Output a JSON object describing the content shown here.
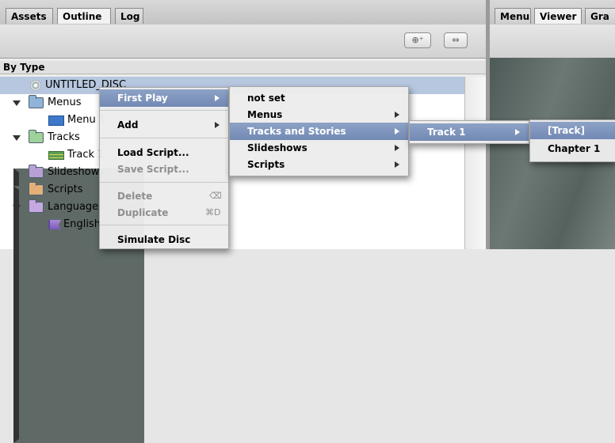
{
  "left_tabs": [
    "Assets",
    "Outline",
    "Log"
  ],
  "active_left_tab": "Outline",
  "right_tabs": [
    "Menu",
    "Viewer",
    "Gra"
  ],
  "active_right_tab": "Viewer",
  "toolbar": {
    "btn1": "⊕⁺",
    "btn2": "⇔"
  },
  "section_header": "By Type",
  "tree": [
    {
      "label": "UNTITLED_DISC",
      "icon": "disc-icon"
    },
    {
      "label": "Menus",
      "icon": "folder-icon",
      "expanded": true
    },
    {
      "label": "Menu 1",
      "icon": "menu-icon"
    },
    {
      "label": "Tracks",
      "icon": "folder-icon",
      "expanded": true
    },
    {
      "label": "Track 1",
      "icon": "track-icon"
    },
    {
      "label": "Slideshows",
      "icon": "folder-icon",
      "expanded": false
    },
    {
      "label": "Scripts",
      "icon": "folder-icon",
      "expanded": false
    },
    {
      "label": "Languages",
      "icon": "folder-icon",
      "expanded": true
    },
    {
      "label": "English",
      "icon": "language-icon"
    }
  ],
  "context_menu": {
    "first_play": "First Play",
    "add": "Add",
    "load_script": "Load Script...",
    "save_script": "Save Script...",
    "delete": "Delete",
    "delete_shortcut": "⌫",
    "duplicate": "Duplicate",
    "duplicate_shortcut": "⌘D",
    "simulate_disc": "Simulate Disc"
  },
  "first_play_submenu": {
    "not_set": "not set",
    "menus": "Menus",
    "tracks_and_stories": "Tracks and Stories",
    "slideshows": "Slideshows",
    "scripts": "Scripts"
  },
  "tracks_submenu": {
    "track1": "Track 1"
  },
  "track1_submenu": {
    "track": "[Track]",
    "chapter1": "Chapter 1"
  }
}
